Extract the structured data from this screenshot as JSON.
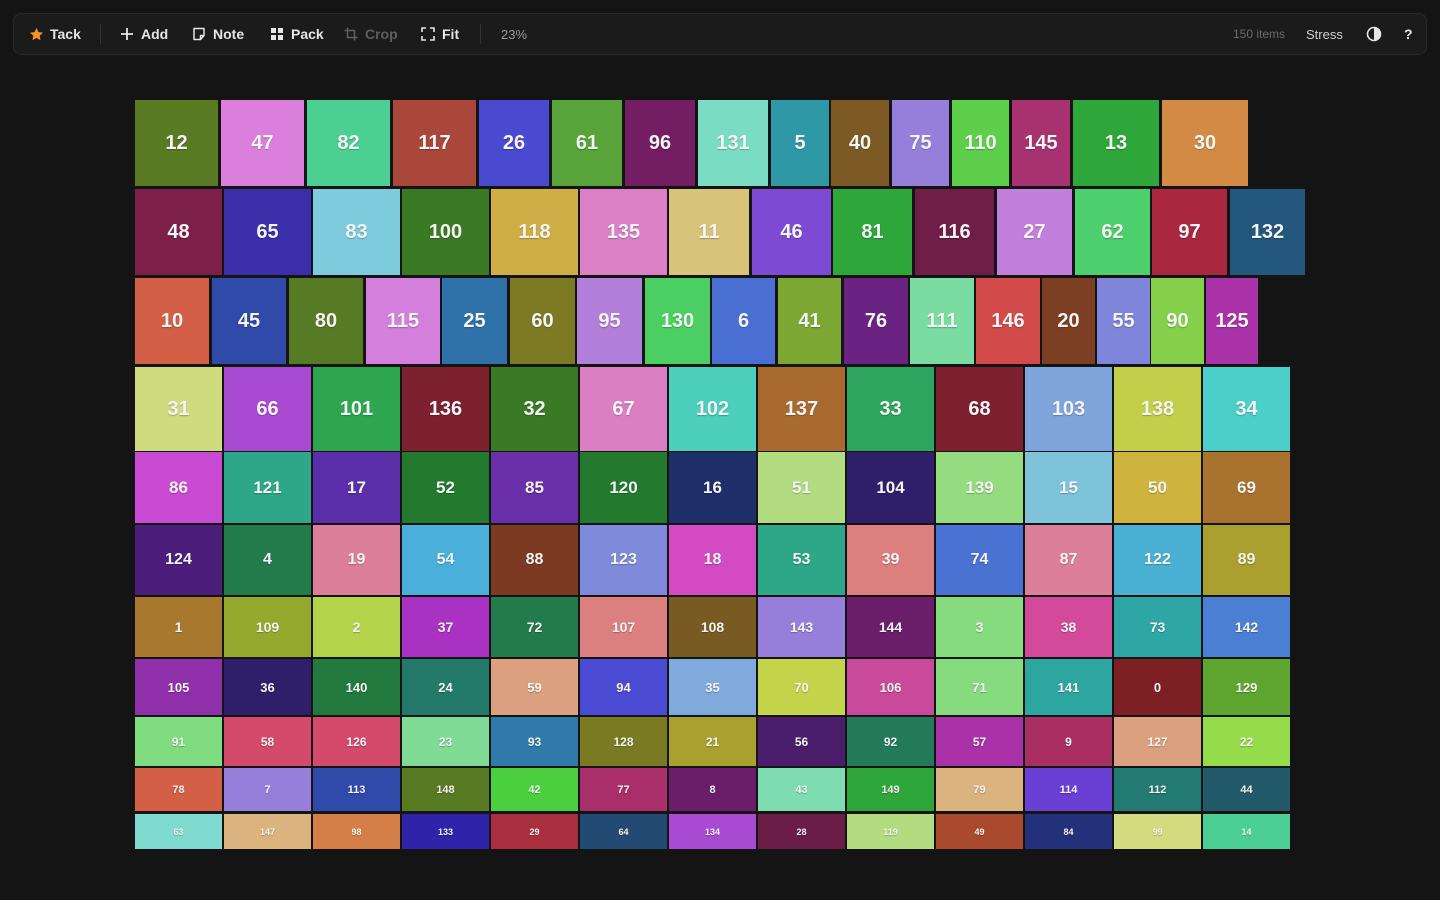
{
  "toolbar": {
    "tack_label": "Tack",
    "add_label": "Add",
    "note_label": "Note",
    "pack_label": "Pack",
    "crop_label": "Crop",
    "fit_label": "Fit",
    "zoom_level": "23%",
    "item_count": "150 items",
    "stress_label": "Stress",
    "help_label": "?",
    "accent": "#f0932b"
  },
  "tiles": [
    {
      "n": "12",
      "c": "#577a22"
    },
    {
      "n": "47",
      "c": "#db7fdd"
    },
    {
      "n": "82",
      "c": "#4ccf92"
    },
    {
      "n": "117",
      "c": "#a9473a"
    },
    {
      "n": "26",
      "c": "#4a4ad0"
    },
    {
      "n": "61",
      "c": "#58a43a"
    },
    {
      "n": "96",
      "c": "#731e62"
    },
    {
      "n": "131",
      "c": "#7adcc3"
    },
    {
      "n": "5",
      "c": "#2f98a7"
    },
    {
      "n": "40",
      "c": "#7d5923"
    },
    {
      "n": "75",
      "c": "#957fdb"
    },
    {
      "n": "110",
      "c": "#5ecf4a"
    },
    {
      "n": "145",
      "c": "#a8326f"
    },
    {
      "n": "13",
      "c": "#2ea63a"
    },
    {
      "n": "30",
      "c": "#d38a45"
    },
    {
      "n": "48",
      "c": "#7d2049"
    },
    {
      "n": "65",
      "c": "#3b2fa9"
    },
    {
      "n": "83",
      "c": "#7dcbdd"
    },
    {
      "n": "100",
      "c": "#3b7a24"
    },
    {
      "n": "118",
      "c": "#cfad47"
    },
    {
      "n": "135",
      "c": "#db7fc7"
    },
    {
      "n": "11",
      "c": "#d8c37a"
    },
    {
      "n": "46",
      "c": "#7d4ad3"
    },
    {
      "n": "81",
      "c": "#2ea63a"
    },
    {
      "n": "116",
      "c": "#6f1e47"
    },
    {
      "n": "27",
      "c": "#c27fdb"
    },
    {
      "n": "62",
      "c": "#4ccf6c"
    },
    {
      "n": "97",
      "c": "#a9273f"
    },
    {
      "n": "132",
      "c": "#23577d"
    },
    {
      "n": "10",
      "c": "#d35f47"
    },
    {
      "n": "45",
      "c": "#2f4aa9"
    },
    {
      "n": "80",
      "c": "#577a24"
    },
    {
      "n": "115",
      "c": "#d37fdb"
    },
    {
      "n": "25",
      "c": "#2f72a9"
    },
    {
      "n": "60",
      "c": "#7d7a24"
    },
    {
      "n": "95",
      "c": "#b27fdb"
    },
    {
      "n": "130",
      "c": "#4ccf62"
    },
    {
      "n": "6",
      "c": "#4a6fd3"
    },
    {
      "n": "41",
      "c": "#7da733"
    },
    {
      "n": "76",
      "c": "#6a2382"
    },
    {
      "n": "111",
      "c": "#7adca1"
    },
    {
      "n": "146",
      "c": "#d34a4a"
    },
    {
      "n": "20",
      "c": "#7d3f23"
    },
    {
      "n": "55",
      "c": "#7f85db"
    },
    {
      "n": "90",
      "c": "#86cf4a"
    },
    {
      "n": "125",
      "c": "#a932a9"
    },
    {
      "n": "31",
      "c": "#cfdb7f"
    },
    {
      "n": "66",
      "c": "#a94ad3"
    },
    {
      "n": "101",
      "c": "#2ea64f"
    },
    {
      "n": "136",
      "c": "#7d2030"
    },
    {
      "n": "32",
      "c": "#3b7a24"
    },
    {
      "n": "67",
      "c": "#db7fc3"
    },
    {
      "n": "102",
      "c": "#4ccfbc"
    },
    {
      "n": "137",
      "c": "#a96a2f"
    },
    {
      "n": "33",
      "c": "#2ea65f"
    },
    {
      "n": "68",
      "c": "#7d2030"
    },
    {
      "n": "103",
      "c": "#7fa3db"
    },
    {
      "n": "138",
      "c": "#c3cf4a"
    },
    {
      "n": "34",
      "c": "#4ccfc9"
    },
    {
      "n": "86",
      "c": "#c94ad3"
    },
    {
      "n": "121",
      "c": "#2ea688"
    },
    {
      "n": "17",
      "c": "#5b2fa9"
    },
    {
      "n": "52",
      "c": "#237a2f"
    },
    {
      "n": "85",
      "c": "#6a2fa9"
    },
    {
      "n": "120",
      "c": "#237a2f"
    },
    {
      "n": "16",
      "c": "#1e2f6a"
    },
    {
      "n": "51",
      "c": "#b3db7f"
    },
    {
      "n": "104",
      "c": "#2f1e6a"
    },
    {
      "n": "139",
      "c": "#95db7f"
    },
    {
      "n": "15",
      "c": "#7fc3db"
    },
    {
      "n": "50",
      "c": "#cfb33f"
    },
    {
      "n": "69",
      "c": "#a9722f"
    },
    {
      "n": "124",
      "c": "#4a1e7a"
    },
    {
      "n": "4",
      "c": "#237a4a"
    },
    {
      "n": "19",
      "c": "#db7f9a"
    },
    {
      "n": "54",
      "c": "#4ab0db"
    },
    {
      "n": "88",
      "c": "#7d3a23"
    },
    {
      "n": "123",
      "c": "#7f8adb"
    },
    {
      "n": "18",
      "c": "#d34ac3"
    },
    {
      "n": "53",
      "c": "#2ea688"
    },
    {
      "n": "39",
      "c": "#db7f7f"
    },
    {
      "n": "74",
      "c": "#4a72d3"
    },
    {
      "n": "87",
      "c": "#db7f9a"
    },
    {
      "n": "122",
      "c": "#4ab0d3"
    },
    {
      "n": "89",
      "c": "#a9a02f"
    },
    {
      "n": "1",
      "c": "#a9782f"
    },
    {
      "n": "109",
      "c": "#95a92f"
    },
    {
      "n": "2",
      "c": "#b3d34a"
    },
    {
      "n": "37",
      "c": "#a932c3"
    },
    {
      "n": "72",
      "c": "#237a4a"
    },
    {
      "n": "107",
      "c": "#db7f7f"
    },
    {
      "n": "108",
      "c": "#7a5a23"
    },
    {
      "n": "143",
      "c": "#957fdb"
    },
    {
      "n": "144",
      "c": "#6a1e6a"
    },
    {
      "n": "3",
      "c": "#86db7f"
    },
    {
      "n": "38",
      "c": "#d34a9a"
    },
    {
      "n": "73",
      "c": "#2ea6a6"
    },
    {
      "n": "142",
      "c": "#4a7fd3"
    },
    {
      "n": "105",
      "c": "#8f2fa9"
    },
    {
      "n": "36",
      "c": "#2f1e6a"
    },
    {
      "n": "140",
      "c": "#237a3f"
    },
    {
      "n": "24",
      "c": "#237a6a"
    },
    {
      "n": "59",
      "c": "#dba07f"
    },
    {
      "n": "94",
      "c": "#4a4ad3"
    },
    {
      "n": "35",
      "c": "#7faadb"
    },
    {
      "n": "70",
      "c": "#c3d34a"
    },
    {
      "n": "106",
      "c": "#c94a9a"
    },
    {
      "n": "71",
      "c": "#86db7f"
    },
    {
      "n": "141",
      "c": "#2ea6a0"
    },
    {
      "n": "0",
      "c": "#7d2023"
    },
    {
      "n": "129",
      "c": "#5ea62f"
    },
    {
      "n": "91",
      "c": "#7fdb7f"
    },
    {
      "n": "58",
      "c": "#d34a6a"
    },
    {
      "n": "126",
      "c": "#d34a6a"
    },
    {
      "n": "23",
      "c": "#7fdb95"
    },
    {
      "n": "93",
      "c": "#2f7aa9"
    },
    {
      "n": "128",
      "c": "#7a7a23"
    },
    {
      "n": "21",
      "c": "#a9a02f"
    },
    {
      "n": "56",
      "c": "#4a1e6a"
    },
    {
      "n": "92",
      "c": "#237a5a"
    },
    {
      "n": "57",
      "c": "#a932a9"
    },
    {
      "n": "9",
      "c": "#a92f62"
    },
    {
      "n": "127",
      "c": "#dba07f"
    },
    {
      "n": "22",
      "c": "#95db4a"
    },
    {
      "n": "78",
      "c": "#d35f47"
    },
    {
      "n": "7",
      "c": "#957fdb"
    },
    {
      "n": "113",
      "c": "#2f4aa9"
    },
    {
      "n": "148",
      "c": "#577a23"
    },
    {
      "n": "42",
      "c": "#4ccf3f"
    },
    {
      "n": "77",
      "c": "#a92f6a"
    },
    {
      "n": "8",
      "c": "#6a1e6a"
    },
    {
      "n": "43",
      "c": "#7fdbb0"
    },
    {
      "n": "149",
      "c": "#2ea63a"
    },
    {
      "n": "79",
      "c": "#dbb37f"
    },
    {
      "n": "114",
      "c": "#6a3fd3"
    },
    {
      "n": "112",
      "c": "#237a72"
    },
    {
      "n": "44",
      "c": "#235a6a"
    },
    {
      "n": "63",
      "c": "#7fdbcf"
    },
    {
      "n": "147",
      "c": "#dbb37f"
    },
    {
      "n": "98",
      "c": "#d37f47"
    },
    {
      "n": "133",
      "c": "#2f23a9"
    },
    {
      "n": "29",
      "c": "#a92f3f"
    },
    {
      "n": "64",
      "c": "#234a72"
    },
    {
      "n": "134",
      "c": "#a94ad3"
    },
    {
      "n": "28",
      "c": "#6a1e47"
    },
    {
      "n": "119",
      "c": "#b3db7f"
    },
    {
      "n": "49",
      "c": "#a94a2f"
    },
    {
      "n": "84",
      "c": "#23307a"
    },
    {
      "n": "99",
      "c": "#d3db7f"
    },
    {
      "n": "14",
      "c": "#4ccf95"
    }
  ]
}
